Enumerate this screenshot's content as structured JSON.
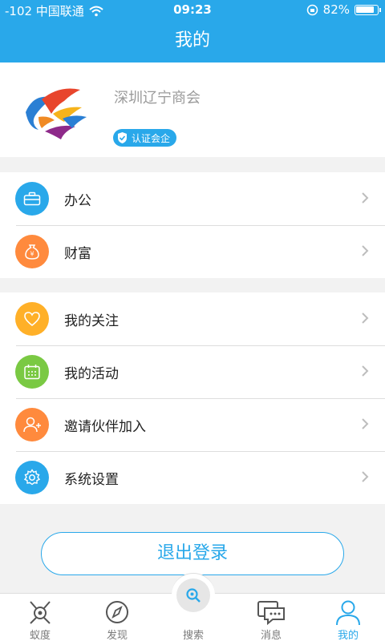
{
  "status_bar": {
    "carrier": "-102 中国联通",
    "time": "09:23",
    "battery": "82%",
    "battery_level": 0.82
  },
  "header": {
    "title": "我的"
  },
  "profile": {
    "name": "深圳辽宁商会",
    "badge": "认证会企"
  },
  "menu_group_1": [
    {
      "label": "办公",
      "icon": "briefcase-icon",
      "color": "#29a8ea"
    },
    {
      "label": "财富",
      "icon": "money-bag-icon",
      "color": "#ff8a3d"
    }
  ],
  "menu_group_2": [
    {
      "label": "我的关注",
      "icon": "heart-icon",
      "color": "#ffb028"
    },
    {
      "label": "我的活动",
      "icon": "calendar-icon",
      "color": "#7ac943"
    },
    {
      "label": "邀请伙伴加入",
      "icon": "add-user-icon",
      "color": "#ff8a3d"
    },
    {
      "label": "系统设置",
      "icon": "gear-icon",
      "color": "#29a8ea"
    }
  ],
  "logout_label": "退出登录",
  "tabs": [
    {
      "label": "蚁度",
      "icon": "ant-icon"
    },
    {
      "label": "发现",
      "icon": "compass-icon"
    },
    {
      "label": "搜索",
      "icon": "search-icon"
    },
    {
      "label": "消息",
      "icon": "message-icon"
    },
    {
      "label": "我的",
      "icon": "user-icon"
    }
  ],
  "colors": {
    "accent": "#29a8ea",
    "background": "#f2f2f2"
  }
}
